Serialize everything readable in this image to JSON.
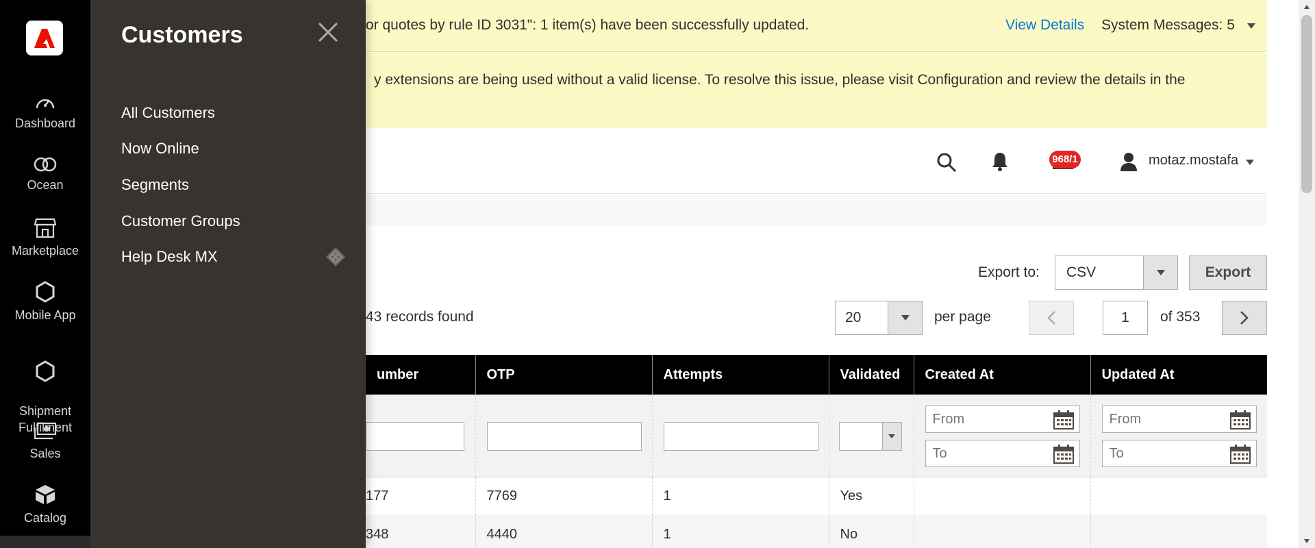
{
  "nav": {
    "items": [
      {
        "label": "Dashboard",
        "icon": "dashboard-icon"
      },
      {
        "label": "Ocean",
        "icon": "ocean-icon"
      },
      {
        "label": "Marketplace",
        "icon": "marketplace-icon"
      },
      {
        "label": "Mobile App",
        "icon": "hexagon-icon"
      },
      {
        "label": "Shipment\nFulfilment",
        "icon": "hexagon-icon"
      },
      {
        "label": "Sales",
        "icon": "sales-icon"
      },
      {
        "label": "Catalog",
        "icon": "catalog-icon"
      }
    ]
  },
  "flyout": {
    "title": "Customers",
    "items": [
      "All Customers",
      "Now Online",
      "Segments",
      "Customer Groups",
      "Help Desk MX"
    ]
  },
  "messages": {
    "first": "or quotes by rule ID 3031\": 1 item(s) have been successfully updated.",
    "view_details": "View Details",
    "system_messages": "System Messages: 5",
    "second": "y extensions are being used without a valid license. To resolve this issue, please visit Configuration and review the details in the"
  },
  "header": {
    "badge": "968/1",
    "username": "motaz.mostafa"
  },
  "toolbar": {
    "export_label": "Export to:",
    "export_value": "CSV",
    "export_button": "Export",
    "records": "43 records found",
    "per_page_value": "20",
    "per_page_label": "per page",
    "page_current": "1",
    "page_total": "of 353"
  },
  "table": {
    "columns": [
      "umber",
      "OTP",
      "Attempts",
      "Validated",
      "Created At",
      "Updated At"
    ],
    "filter_from": "From",
    "filter_to": "To",
    "rows": [
      [
        "177",
        "7769",
        "1",
        "Yes",
        "",
        ""
      ],
      [
        "348",
        "4440",
        "1",
        "No",
        "",
        ""
      ]
    ]
  },
  "colors": {
    "message_bg": "#fcf9c4",
    "nav_bg": "#000000",
    "flyout_bg": "#373330",
    "accent": "#eb5202",
    "link": "#007bdb",
    "badge": "#e22626"
  }
}
